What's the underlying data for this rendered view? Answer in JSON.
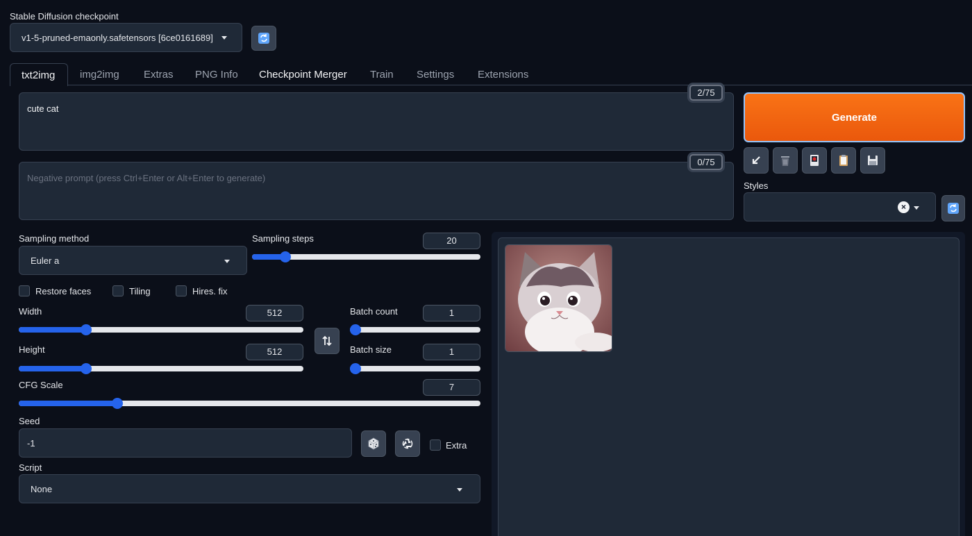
{
  "checkpoint": {
    "label": "Stable Diffusion checkpoint",
    "value": "v1-5-pruned-emaonly.safetensors [6ce0161689]"
  },
  "tabs": [
    {
      "label": "txt2img"
    },
    {
      "label": "img2img"
    },
    {
      "label": "Extras"
    },
    {
      "label": "PNG Info"
    },
    {
      "label": "Checkpoint Merger"
    },
    {
      "label": "Train"
    },
    {
      "label": "Settings"
    },
    {
      "label": "Extensions"
    }
  ],
  "prompt": {
    "value": "cute cat",
    "counter": "2/75"
  },
  "negative_prompt": {
    "placeholder": "Negative prompt (press Ctrl+Enter or Alt+Enter to generate)",
    "counter": "0/75"
  },
  "generate": {
    "label": "Generate"
  },
  "styles": {
    "label": "Styles"
  },
  "sampling_method": {
    "label": "Sampling method",
    "value": "Euler a"
  },
  "sampling_steps": {
    "label": "Sampling steps",
    "value": "20",
    "min": 1,
    "max": 150
  },
  "options": {
    "restore_faces": "Restore faces",
    "tiling": "Tiling",
    "hires_fix": "Hires. fix"
  },
  "width": {
    "label": "Width",
    "value": "512",
    "min": 64,
    "max": 2048
  },
  "height": {
    "label": "Height",
    "value": "512",
    "min": 64,
    "max": 2048
  },
  "batch_count": {
    "label": "Batch count",
    "value": "1",
    "min": 1,
    "max": 100
  },
  "batch_size": {
    "label": "Batch size",
    "value": "1",
    "min": 1,
    "max": 8
  },
  "cfg_scale": {
    "label": "CFG Scale",
    "value": "7",
    "min": 1,
    "max": 30
  },
  "seed": {
    "label": "Seed",
    "value": "-1",
    "extra_label": "Extra"
  },
  "script": {
    "label": "Script",
    "value": "None"
  },
  "colors": {
    "accent": "#2563eb",
    "generate": "#f97316",
    "background": "#0b0f19",
    "panel": "#1f2937"
  }
}
